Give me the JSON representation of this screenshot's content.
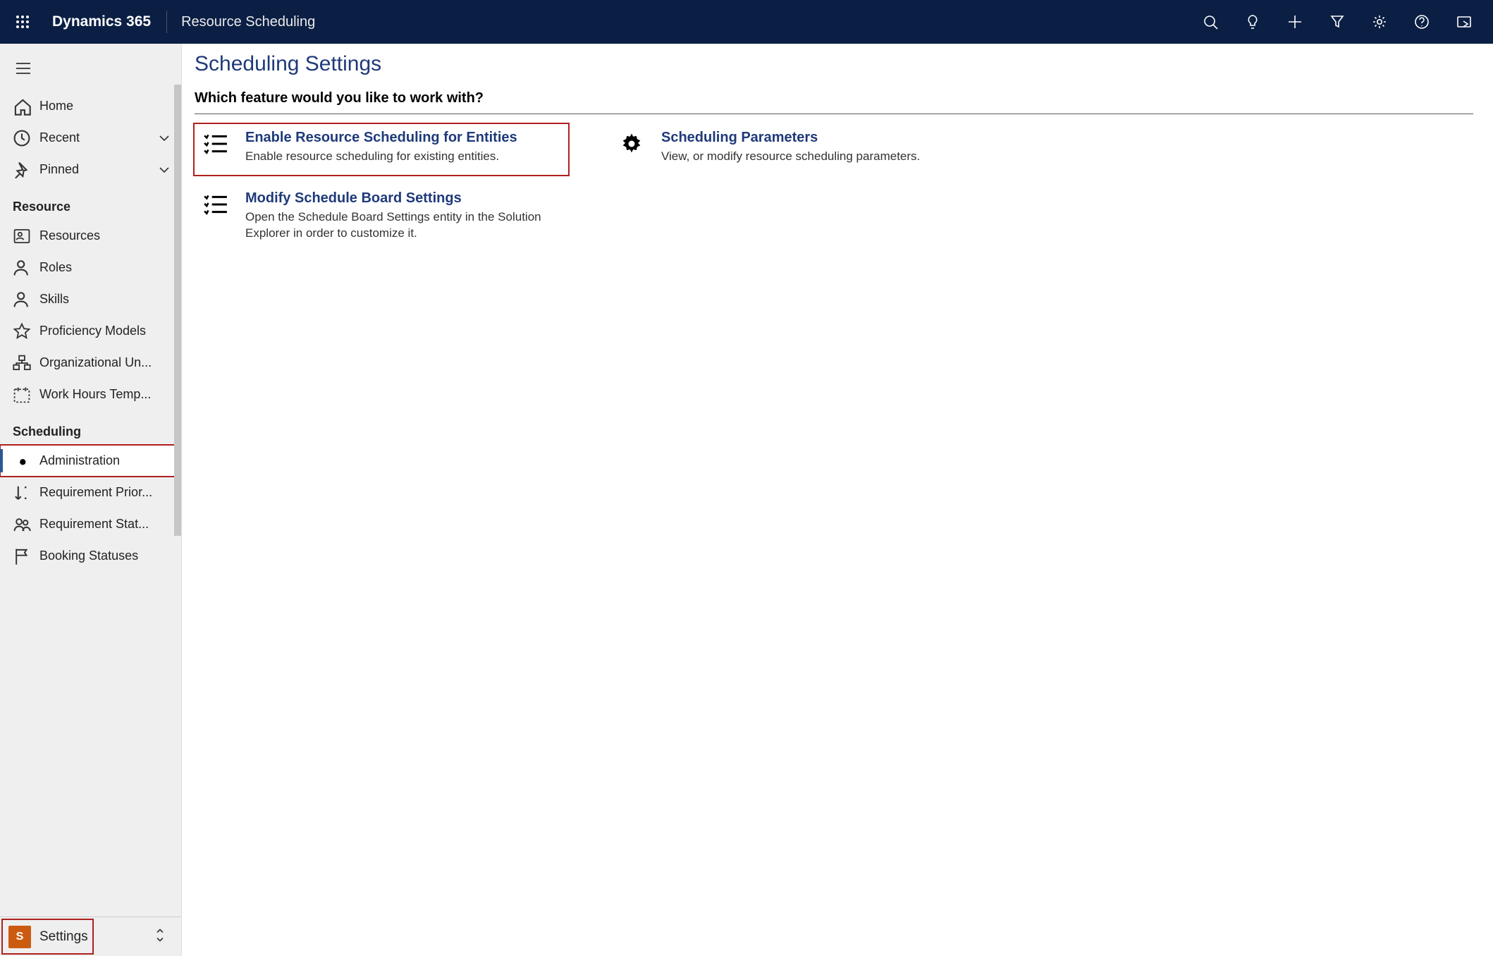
{
  "header": {
    "brand": "Dynamics 365",
    "app_name": "Resource Scheduling"
  },
  "sidebar": {
    "top_items": [
      {
        "icon": "home",
        "label": "Home",
        "expandable": false
      },
      {
        "icon": "clock",
        "label": "Recent",
        "expandable": true
      },
      {
        "icon": "pin",
        "label": "Pinned",
        "expandable": true
      }
    ],
    "sections": [
      {
        "title": "Resource",
        "items": [
          {
            "icon": "person-card",
            "label": "Resources"
          },
          {
            "icon": "person",
            "label": "Roles"
          },
          {
            "icon": "person",
            "label": "Skills"
          },
          {
            "icon": "star",
            "label": "Proficiency Models"
          },
          {
            "icon": "org",
            "label": "Organizational Un..."
          },
          {
            "icon": "calendar-dotted",
            "label": "Work Hours Temp..."
          }
        ]
      },
      {
        "title": "Scheduling",
        "items": [
          {
            "icon": "gear",
            "label": "Administration",
            "selected": true,
            "highlight": true
          },
          {
            "icon": "sort-down",
            "label": "Requirement Prior..."
          },
          {
            "icon": "people",
            "label": "Requirement Stat..."
          },
          {
            "icon": "flag",
            "label": "Booking Statuses"
          }
        ]
      }
    ],
    "footer": {
      "badge": "S",
      "label": "Settings",
      "highlight": true
    }
  },
  "main": {
    "page_title": "Scheduling Settings",
    "subtitle": "Which feature would you like to work with?",
    "left_tiles": [
      {
        "title": "Enable Resource Scheduling for Entities",
        "desc": "Enable resource scheduling for existing entities.",
        "icon": "checklist",
        "highlight": true
      },
      {
        "title": "Modify Schedule Board Settings",
        "desc": "Open the Schedule Board Settings entity in the Solution Explorer in order to customize it.",
        "icon": "checklist"
      }
    ],
    "right_tiles": [
      {
        "title": "Scheduling Parameters",
        "desc": "View, or modify resource scheduling parameters.",
        "icon": "gear-solid"
      }
    ]
  }
}
